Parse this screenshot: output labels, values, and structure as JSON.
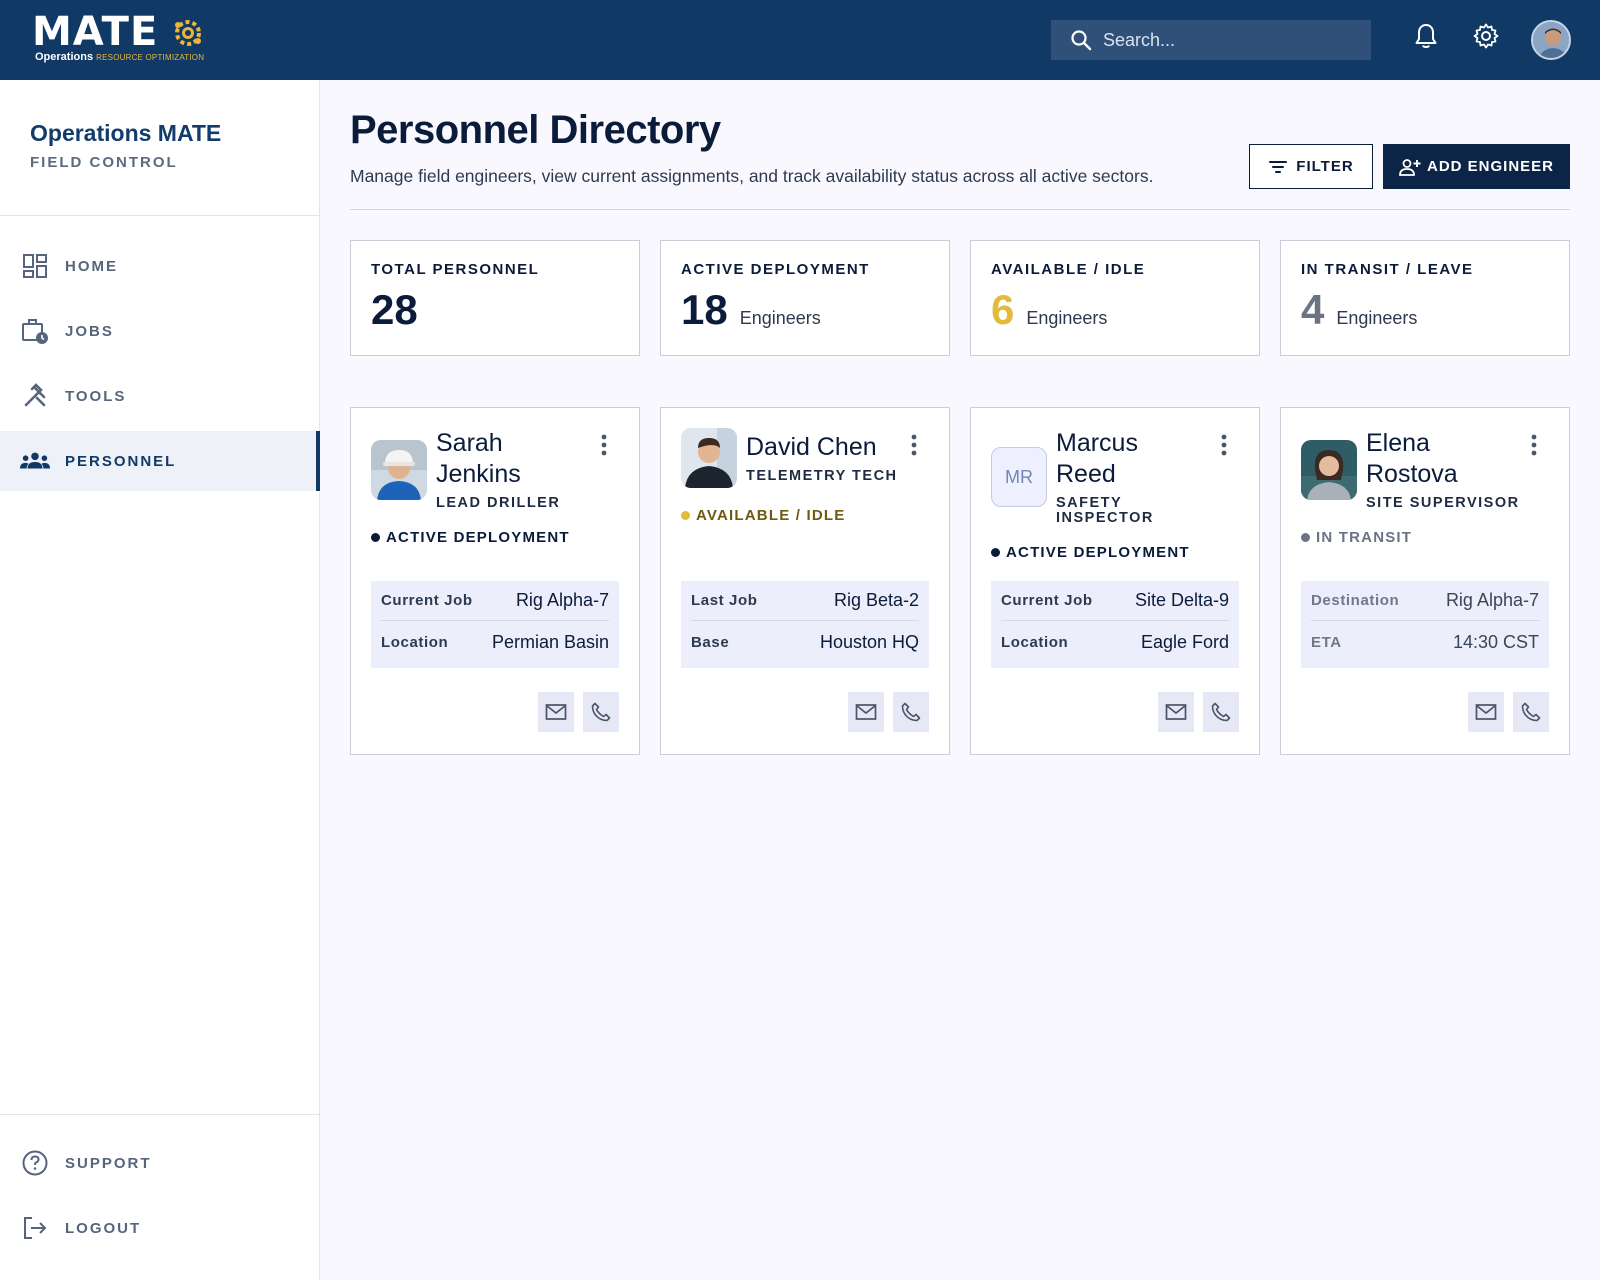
{
  "header": {
    "logo_word": "MATE",
    "logo_operations": "Operations",
    "logo_tagline": "RESOURCE OPTIMIZATION",
    "search_placeholder": "Search...",
    "icons": [
      "search-icon",
      "bell-icon",
      "gear-icon",
      "user-avatar"
    ]
  },
  "sidebar": {
    "brand_title": "Operations MATE",
    "brand_subtitle": "FIELD CONTROL",
    "items": [
      {
        "label": "HOME",
        "icon": "dashboard-icon",
        "active": false
      },
      {
        "label": "JOBS",
        "icon": "briefcase-clock-icon",
        "active": false
      },
      {
        "label": "TOOLS",
        "icon": "tools-icon",
        "active": false
      },
      {
        "label": "PERSONNEL",
        "icon": "people-icon",
        "active": true
      }
    ],
    "footer_items": [
      {
        "label": "SUPPORT",
        "icon": "help-icon"
      },
      {
        "label": "LOGOUT",
        "icon": "logout-icon"
      }
    ]
  },
  "main": {
    "title": "Personnel Directory",
    "description": "Manage field engineers, view current assignments, and track availability status across all active sectors.",
    "filter_label": "FILTER",
    "add_label": "ADD ENGINEER"
  },
  "stats": [
    {
      "label": "TOTAL PERSONNEL",
      "value": "28",
      "unit": "",
      "color": "#0b1b3a"
    },
    {
      "label": "ACTIVE DEPLOYMENT",
      "value": "18",
      "unit": "Engineers",
      "color": "#0b1b3a"
    },
    {
      "label": "AVAILABLE / IDLE",
      "value": "6",
      "unit": "Engineers",
      "color": "#e2bb3c"
    },
    {
      "label": "IN TRANSIT / LEAVE",
      "value": "4",
      "unit": "Engineers",
      "color": "#6b7384"
    }
  ],
  "engineers": [
    {
      "name_line1": "Sarah",
      "name_line2": "Jenkins",
      "role_line1": "LEAD DRILLER",
      "role_line2": "",
      "status": "ACTIVE DEPLOYMENT",
      "status_color": "#0b1b3a",
      "dot_color": "#0b1b3a",
      "detail_1_key": "Current Job",
      "detail_1_val": "Rig Alpha-7",
      "detail_2_key": "Location",
      "detail_2_val": "Permian Basin",
      "initials": ""
    },
    {
      "name_line1": "David Chen",
      "name_line2": "",
      "role_line1": "TELEMETRY TECH",
      "role_line2": "",
      "status": "AVAILABLE / IDLE",
      "status_color": "#6e5b12",
      "dot_color": "#e2bb3c",
      "detail_1_key": "Last Job",
      "detail_1_val": "Rig Beta-2",
      "detail_2_key": "Base",
      "detail_2_val": "Houston HQ",
      "initials": ""
    },
    {
      "name_line1": "Marcus",
      "name_line2": "Reed",
      "role_line1": "SAFETY",
      "role_line2": "INSPECTOR",
      "status": "ACTIVE DEPLOYMENT",
      "status_color": "#0b1b3a",
      "dot_color": "#0b1b3a",
      "detail_1_key": "Current Job",
      "detail_1_val": "Site Delta-9",
      "detail_2_key": "Location",
      "detail_2_val": "Eagle Ford",
      "initials": "MR"
    },
    {
      "name_line1": "Elena",
      "name_line2": "Rostova",
      "role_line1": "SITE SUPERVISOR",
      "role_line2": "",
      "status": "IN TRANSIT",
      "status_color": "#6b7384",
      "dot_color": "#6b7384",
      "detail_1_key": "Destination",
      "detail_1_val": "Rig Alpha-7",
      "detail_2_key": "ETA",
      "detail_2_val": "14:30 CST",
      "initials": ""
    }
  ]
}
